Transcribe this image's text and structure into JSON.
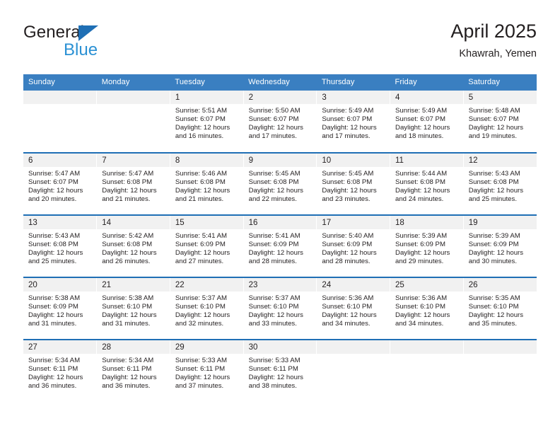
{
  "brand": {
    "name_top": "General",
    "name_bottom": "Blue",
    "logo_icon": "blue-triangle-logo",
    "accent_color": "#1f6fb5",
    "blue_text_color": "#2b91d4"
  },
  "header": {
    "title": "April 2025",
    "subtitle": "Khawrah, Yemen"
  },
  "calendar": {
    "header_bg": "#3a7fc1",
    "daynum_bg": "#f1f1f1",
    "row_border_color": "#1f6fb5",
    "weekdays": [
      "Sunday",
      "Monday",
      "Tuesday",
      "Wednesday",
      "Thursday",
      "Friday",
      "Saturday"
    ],
    "weeks": [
      [
        {
          "day": "",
          "sunrise": "",
          "sunset": "",
          "daylight": "",
          "daylight2": ""
        },
        {
          "day": "",
          "sunrise": "",
          "sunset": "",
          "daylight": "",
          "daylight2": ""
        },
        {
          "day": "1",
          "sunrise": "Sunrise: 5:51 AM",
          "sunset": "Sunset: 6:07 PM",
          "daylight": "Daylight: 12 hours",
          "daylight2": "and 16 minutes."
        },
        {
          "day": "2",
          "sunrise": "Sunrise: 5:50 AM",
          "sunset": "Sunset: 6:07 PM",
          "daylight": "Daylight: 12 hours",
          "daylight2": "and 17 minutes."
        },
        {
          "day": "3",
          "sunrise": "Sunrise: 5:49 AM",
          "sunset": "Sunset: 6:07 PM",
          "daylight": "Daylight: 12 hours",
          "daylight2": "and 17 minutes."
        },
        {
          "day": "4",
          "sunrise": "Sunrise: 5:49 AM",
          "sunset": "Sunset: 6:07 PM",
          "daylight": "Daylight: 12 hours",
          "daylight2": "and 18 minutes."
        },
        {
          "day": "5",
          "sunrise": "Sunrise: 5:48 AM",
          "sunset": "Sunset: 6:07 PM",
          "daylight": "Daylight: 12 hours",
          "daylight2": "and 19 minutes."
        }
      ],
      [
        {
          "day": "6",
          "sunrise": "Sunrise: 5:47 AM",
          "sunset": "Sunset: 6:07 PM",
          "daylight": "Daylight: 12 hours",
          "daylight2": "and 20 minutes."
        },
        {
          "day": "7",
          "sunrise": "Sunrise: 5:47 AM",
          "sunset": "Sunset: 6:08 PM",
          "daylight": "Daylight: 12 hours",
          "daylight2": "and 21 minutes."
        },
        {
          "day": "8",
          "sunrise": "Sunrise: 5:46 AM",
          "sunset": "Sunset: 6:08 PM",
          "daylight": "Daylight: 12 hours",
          "daylight2": "and 21 minutes."
        },
        {
          "day": "9",
          "sunrise": "Sunrise: 5:45 AM",
          "sunset": "Sunset: 6:08 PM",
          "daylight": "Daylight: 12 hours",
          "daylight2": "and 22 minutes."
        },
        {
          "day": "10",
          "sunrise": "Sunrise: 5:45 AM",
          "sunset": "Sunset: 6:08 PM",
          "daylight": "Daylight: 12 hours",
          "daylight2": "and 23 minutes."
        },
        {
          "day": "11",
          "sunrise": "Sunrise: 5:44 AM",
          "sunset": "Sunset: 6:08 PM",
          "daylight": "Daylight: 12 hours",
          "daylight2": "and 24 minutes."
        },
        {
          "day": "12",
          "sunrise": "Sunrise: 5:43 AM",
          "sunset": "Sunset: 6:08 PM",
          "daylight": "Daylight: 12 hours",
          "daylight2": "and 25 minutes."
        }
      ],
      [
        {
          "day": "13",
          "sunrise": "Sunrise: 5:43 AM",
          "sunset": "Sunset: 6:08 PM",
          "daylight": "Daylight: 12 hours",
          "daylight2": "and 25 minutes."
        },
        {
          "day": "14",
          "sunrise": "Sunrise: 5:42 AM",
          "sunset": "Sunset: 6:08 PM",
          "daylight": "Daylight: 12 hours",
          "daylight2": "and 26 minutes."
        },
        {
          "day": "15",
          "sunrise": "Sunrise: 5:41 AM",
          "sunset": "Sunset: 6:09 PM",
          "daylight": "Daylight: 12 hours",
          "daylight2": "and 27 minutes."
        },
        {
          "day": "16",
          "sunrise": "Sunrise: 5:41 AM",
          "sunset": "Sunset: 6:09 PM",
          "daylight": "Daylight: 12 hours",
          "daylight2": "and 28 minutes."
        },
        {
          "day": "17",
          "sunrise": "Sunrise: 5:40 AM",
          "sunset": "Sunset: 6:09 PM",
          "daylight": "Daylight: 12 hours",
          "daylight2": "and 28 minutes."
        },
        {
          "day": "18",
          "sunrise": "Sunrise: 5:39 AM",
          "sunset": "Sunset: 6:09 PM",
          "daylight": "Daylight: 12 hours",
          "daylight2": "and 29 minutes."
        },
        {
          "day": "19",
          "sunrise": "Sunrise: 5:39 AM",
          "sunset": "Sunset: 6:09 PM",
          "daylight": "Daylight: 12 hours",
          "daylight2": "and 30 minutes."
        }
      ],
      [
        {
          "day": "20",
          "sunrise": "Sunrise: 5:38 AM",
          "sunset": "Sunset: 6:09 PM",
          "daylight": "Daylight: 12 hours",
          "daylight2": "and 31 minutes."
        },
        {
          "day": "21",
          "sunrise": "Sunrise: 5:38 AM",
          "sunset": "Sunset: 6:10 PM",
          "daylight": "Daylight: 12 hours",
          "daylight2": "and 31 minutes."
        },
        {
          "day": "22",
          "sunrise": "Sunrise: 5:37 AM",
          "sunset": "Sunset: 6:10 PM",
          "daylight": "Daylight: 12 hours",
          "daylight2": "and 32 minutes."
        },
        {
          "day": "23",
          "sunrise": "Sunrise: 5:37 AM",
          "sunset": "Sunset: 6:10 PM",
          "daylight": "Daylight: 12 hours",
          "daylight2": "and 33 minutes."
        },
        {
          "day": "24",
          "sunrise": "Sunrise: 5:36 AM",
          "sunset": "Sunset: 6:10 PM",
          "daylight": "Daylight: 12 hours",
          "daylight2": "and 34 minutes."
        },
        {
          "day": "25",
          "sunrise": "Sunrise: 5:36 AM",
          "sunset": "Sunset: 6:10 PM",
          "daylight": "Daylight: 12 hours",
          "daylight2": "and 34 minutes."
        },
        {
          "day": "26",
          "sunrise": "Sunrise: 5:35 AM",
          "sunset": "Sunset: 6:10 PM",
          "daylight": "Daylight: 12 hours",
          "daylight2": "and 35 minutes."
        }
      ],
      [
        {
          "day": "27",
          "sunrise": "Sunrise: 5:34 AM",
          "sunset": "Sunset: 6:11 PM",
          "daylight": "Daylight: 12 hours",
          "daylight2": "and 36 minutes."
        },
        {
          "day": "28",
          "sunrise": "Sunrise: 5:34 AM",
          "sunset": "Sunset: 6:11 PM",
          "daylight": "Daylight: 12 hours",
          "daylight2": "and 36 minutes."
        },
        {
          "day": "29",
          "sunrise": "Sunrise: 5:33 AM",
          "sunset": "Sunset: 6:11 PM",
          "daylight": "Daylight: 12 hours",
          "daylight2": "and 37 minutes."
        },
        {
          "day": "30",
          "sunrise": "Sunrise: 5:33 AM",
          "sunset": "Sunset: 6:11 PM",
          "daylight": "Daylight: 12 hours",
          "daylight2": "and 38 minutes."
        },
        {
          "day": "",
          "sunrise": "",
          "sunset": "",
          "daylight": "",
          "daylight2": ""
        },
        {
          "day": "",
          "sunrise": "",
          "sunset": "",
          "daylight": "",
          "daylight2": ""
        },
        {
          "day": "",
          "sunrise": "",
          "sunset": "",
          "daylight": "",
          "daylight2": ""
        }
      ]
    ]
  }
}
